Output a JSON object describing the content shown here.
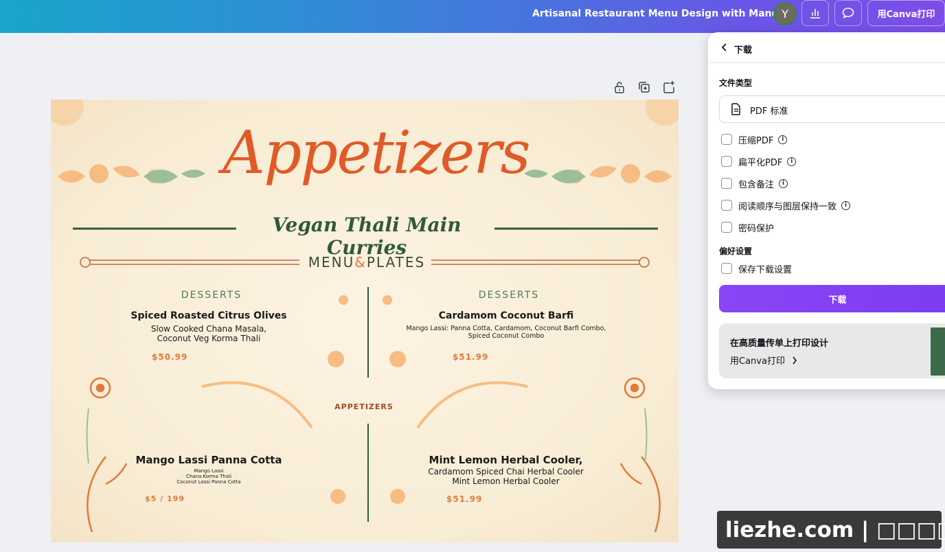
{
  "topbar": {
    "doc_title": "Artisanal Restaurant Menu Design with Mandala",
    "avatar_initial": "Y",
    "print_button": "用Canva打印",
    "gradient_colors": [
      "#19a6c9",
      "#7d4de8"
    ]
  },
  "design": {
    "headline": "Appetizers",
    "subheading": "Vegan Thali Main Curries",
    "banner_left": "MENU",
    "banner_amp": "&",
    "banner_right": "PLATES",
    "center_label": "APPETIZERS",
    "items": [
      {
        "category": "DESSERTS",
        "name": "Spiced Roasted Citrus Olives",
        "desc_lines": [
          "Slow Cooked Chana Masala,",
          "Coconut Veg Korma Thali"
        ],
        "price": "$50.99"
      },
      {
        "category": "DESSERTS",
        "name": "Cardamom Coconut Barfi",
        "desc_lines": [
          "Mango Lassi: Panna Cotta, Cardamom, Coconut Barfi Combo,",
          "Spiced Coconut Combo"
        ],
        "price": "$51.99"
      },
      {
        "name": "Mango Lassi Panna Cotta",
        "desc_lines": [
          "Mango Lassi",
          "Chana Korma Thali",
          "Coconut Lassi Panna Cotta"
        ],
        "price": "$5 / 199"
      },
      {
        "name": "Mint Lemon Herbal Cooler,",
        "desc_lines": [
          "Cardamom Spiced Chai  Herbal Cooler",
          "Mint Lemon Herbal Cooler"
        ],
        "price": "$51.99"
      }
    ],
    "colors": {
      "headline": "#e05a28",
      "subheading": "#2f5a3a",
      "category": "#4e7a5a",
      "price": "#e07a3a",
      "background": "#f8ecd4"
    }
  },
  "download_panel": {
    "title": "下载",
    "file_type_label": "文件类型",
    "file_type_value": "PDF 标准",
    "options": [
      {
        "label": "压缩PDF",
        "checked": false,
        "info": true
      },
      {
        "label": "扁平化PDF",
        "checked": false,
        "info": true
      },
      {
        "label": "包含备注",
        "checked": false,
        "info": true
      },
      {
        "label": "阅读顺序与图层保持一致",
        "checked": false,
        "info": true
      },
      {
        "label": "密码保护",
        "checked": false,
        "info": false
      }
    ],
    "preferences_label": "偏好设置",
    "save_settings": {
      "label": "保存下载设置",
      "checked": false
    },
    "download_button": "下载",
    "download_color": "#8a45f6",
    "promo_title": "在高质量传单上打印设计",
    "promo_link": "用Canva打印"
  },
  "watermark": "liezhe.com | □□□□"
}
